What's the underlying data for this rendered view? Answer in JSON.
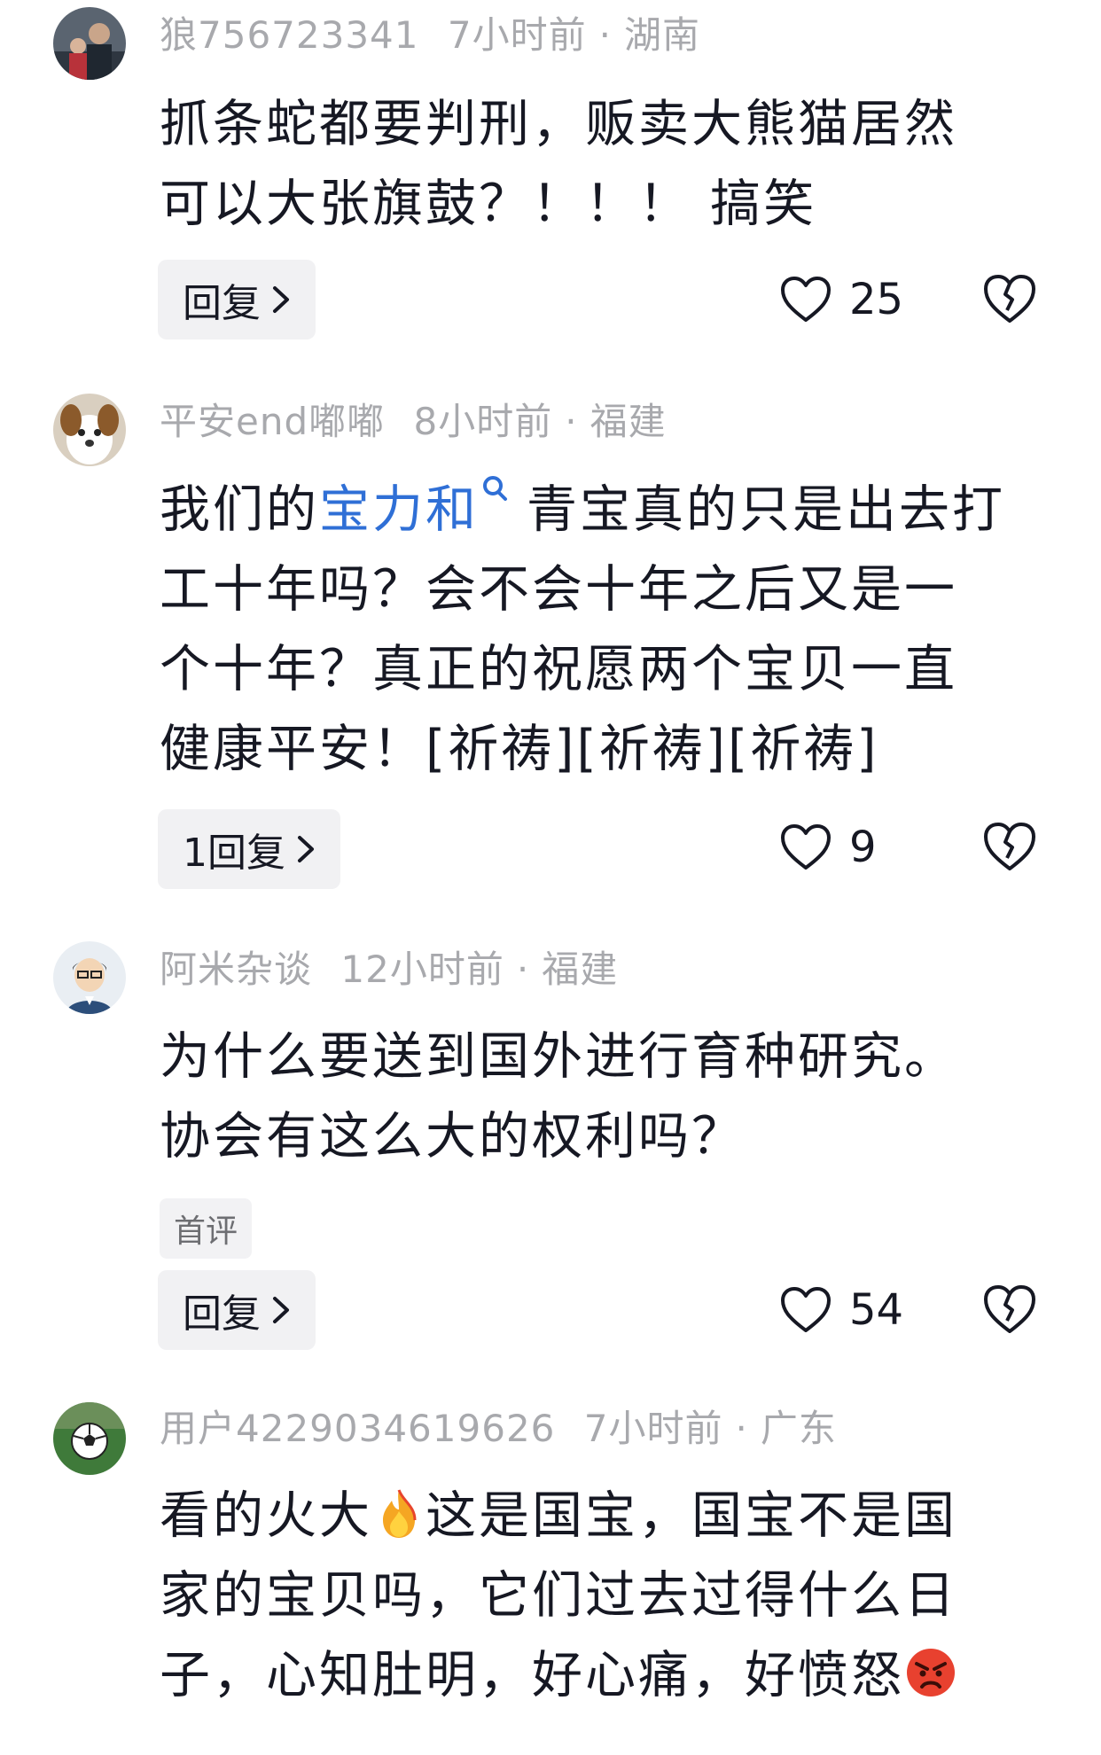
{
  "comments": [
    {
      "username": "狼756723341",
      "time": "7小时前",
      "location": "湖南",
      "lines": [
        "抓条蛇都要判刑，贩卖大熊猫居然",
        "可以大张旗鼓？！！！ 搞笑"
      ],
      "reply_label": "回复",
      "likes": "25",
      "avatar_icon": "avatar-family-photo-icon"
    },
    {
      "username": "平安end嘟嘟",
      "time": "8小时前",
      "location": "福建",
      "line1_prefix": "我们的",
      "line1_link": "宝力和",
      "line1_suffix": "青宝真的只是出去打",
      "lines": [
        "工十年吗？会不会十年之后又是一",
        "个十年？真正的祝愿两个宝贝一直",
        "健康平安！[祈祷][祈祷][祈祷]"
      ],
      "reply_label": "1回复",
      "likes": "9",
      "avatar_icon": "avatar-dog-icon"
    },
    {
      "username": "阿米杂谈",
      "time": "12小时前",
      "location": "福建",
      "lines": [
        "为什么要送到国外进行育种研究。",
        "协会有这么大的权利吗？"
      ],
      "tag": "首评",
      "reply_label": "回复",
      "likes": "54",
      "avatar_icon": "avatar-cartoon-man-icon"
    },
    {
      "username": "用户4229034619626",
      "time": "7小时前",
      "location": "广东",
      "line1_prefix": "看的火大",
      "line1_suffix": "这是国宝，国宝不是国",
      "line2": "家的宝贝吗，它们过去过得什么日",
      "line3": "子，心知肚明，好心痛，好愤怒",
      "avatar_icon": "avatar-soccer-ball-icon"
    }
  ],
  "separator": "·",
  "colors": {
    "text": "#161823",
    "meta": "#a8a9ad",
    "link": "#2f6fd6",
    "button_bg": "#f1f1f3"
  }
}
